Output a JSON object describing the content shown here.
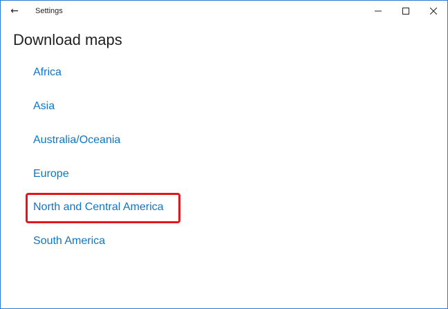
{
  "window": {
    "title": "Settings",
    "controls": {
      "minimize_icon": "minimize-icon",
      "maximize_icon": "maximize-icon",
      "close_icon": "close-icon"
    }
  },
  "page": {
    "title": "Download maps"
  },
  "regions": [
    {
      "label": "Africa"
    },
    {
      "label": "Asia"
    },
    {
      "label": "Australia/Oceania"
    },
    {
      "label": "Europe"
    },
    {
      "label": "North and Central America",
      "highlighted": true
    },
    {
      "label": "South America"
    }
  ],
  "colors": {
    "link": "#0f75c6",
    "highlight": "#e0161b",
    "window_border": "#2b79d6"
  }
}
